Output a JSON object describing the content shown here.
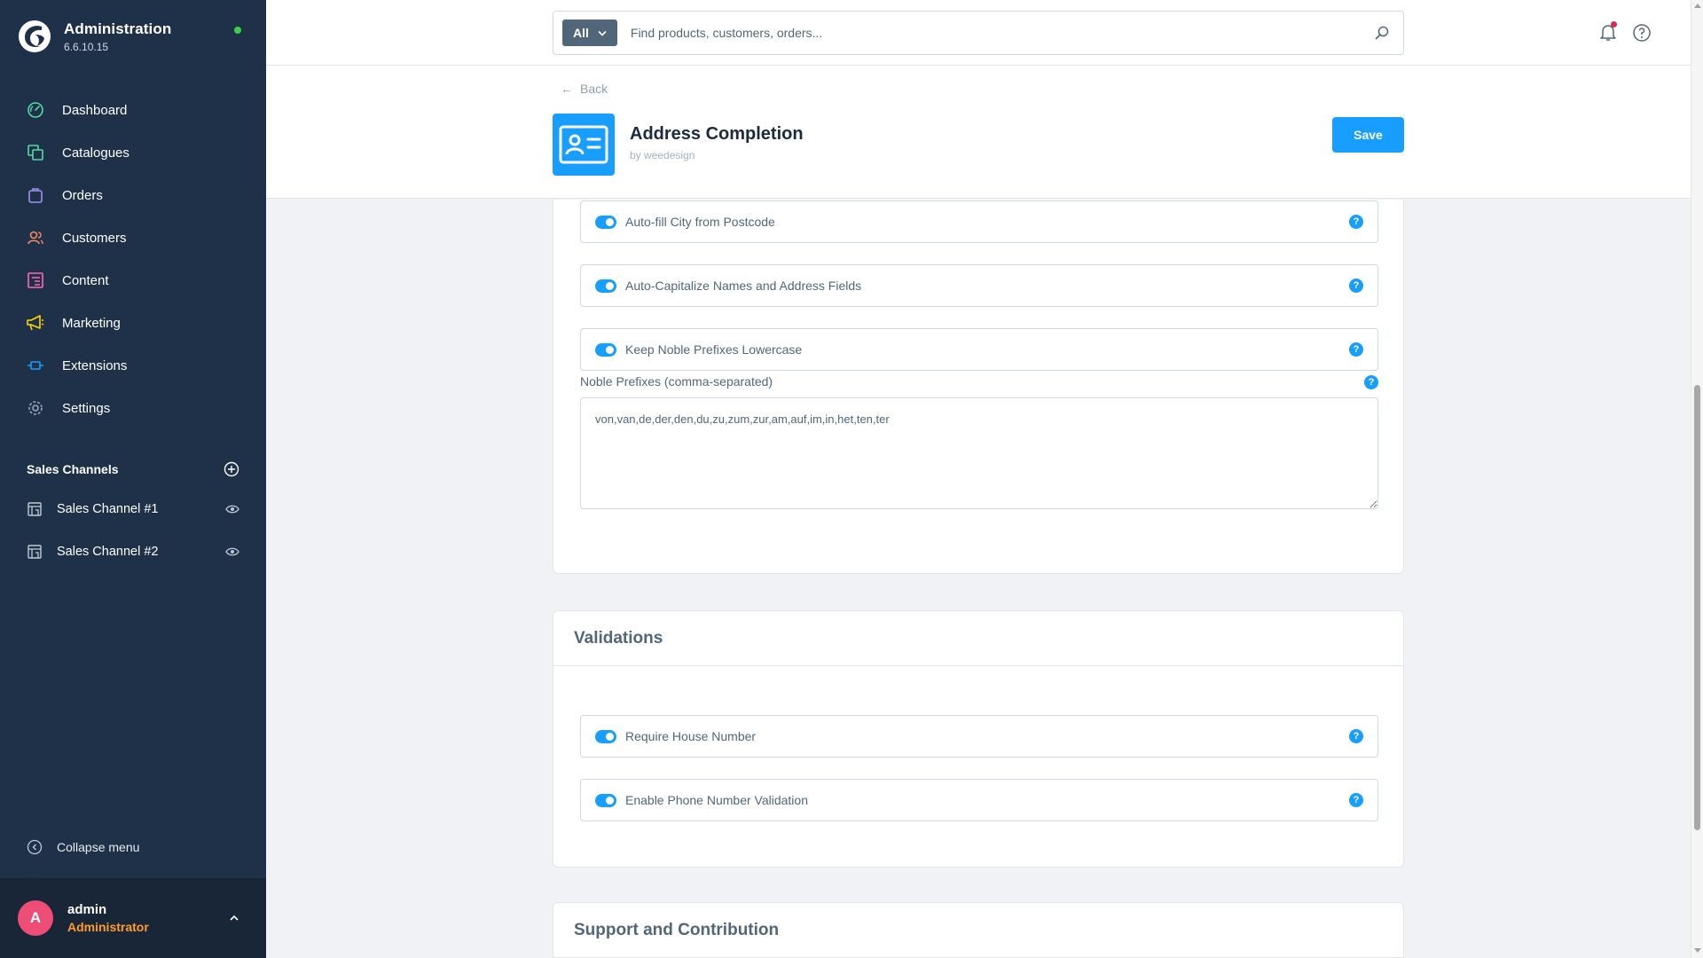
{
  "app": {
    "title": "Administration",
    "version": "6.6.10.15"
  },
  "nav": {
    "items": [
      {
        "label": "Dashboard",
        "icon": "dashboard-icon",
        "color": "#57d9a3"
      },
      {
        "label": "Catalogues",
        "icon": "catalogue-icon",
        "color": "#57d9a3"
      },
      {
        "label": "Orders",
        "icon": "bag-icon",
        "color": "#a092f0"
      },
      {
        "label": "Customers",
        "icon": "users-icon",
        "color": "#f88962"
      },
      {
        "label": "Content",
        "icon": "content-icon",
        "color": "#ff68b4"
      },
      {
        "label": "Marketing",
        "icon": "megaphone-icon",
        "color": "#ffd700"
      },
      {
        "label": "Extensions",
        "icon": "plug-icon",
        "color": "#189eff"
      },
      {
        "label": "Settings",
        "icon": "gear-icon",
        "color": "#9aa8b5"
      }
    ]
  },
  "sales_channels": {
    "title": "Sales Channels",
    "items": [
      {
        "label": "Sales Channel #1"
      },
      {
        "label": "Sales Channel #2"
      }
    ]
  },
  "sidebar_footer": {
    "collapse_label": "Collapse menu",
    "user_initial": "A",
    "user_name": "admin",
    "user_role": "Administrator"
  },
  "search": {
    "type_label": "All",
    "placeholder": "Find products, customers, orders..."
  },
  "header": {
    "back_label": "Back",
    "title": "Address Completion",
    "author": "by weedesign",
    "save_label": "Save"
  },
  "settings_card": {
    "switches": [
      {
        "label": "Auto-fill City from Postcode",
        "enabled": true
      },
      {
        "label": "Auto-Capitalize Names and Address Fields",
        "enabled": true
      },
      {
        "label": "Keep Noble Prefixes Lowercase",
        "enabled": true
      }
    ],
    "noble_prefixes_label": "Noble Prefixes (comma-separated)",
    "noble_prefixes_value": "von,van,de,der,den,du,zu,zum,zur,am,auf,im,in,het,ten,ter"
  },
  "validations_card": {
    "title": "Validations",
    "switches": [
      {
        "label": "Require House Number",
        "enabled": true
      },
      {
        "label": "Enable Phone Number Validation",
        "enabled": true
      }
    ]
  },
  "support_card": {
    "title": "Support and Contribution"
  },
  "colors": {
    "sidebar_bg": "#1f3149",
    "accent": "#189eff",
    "online": "#37d046",
    "user_role": "#ff9c2c",
    "avatar": "#ee4d77"
  }
}
